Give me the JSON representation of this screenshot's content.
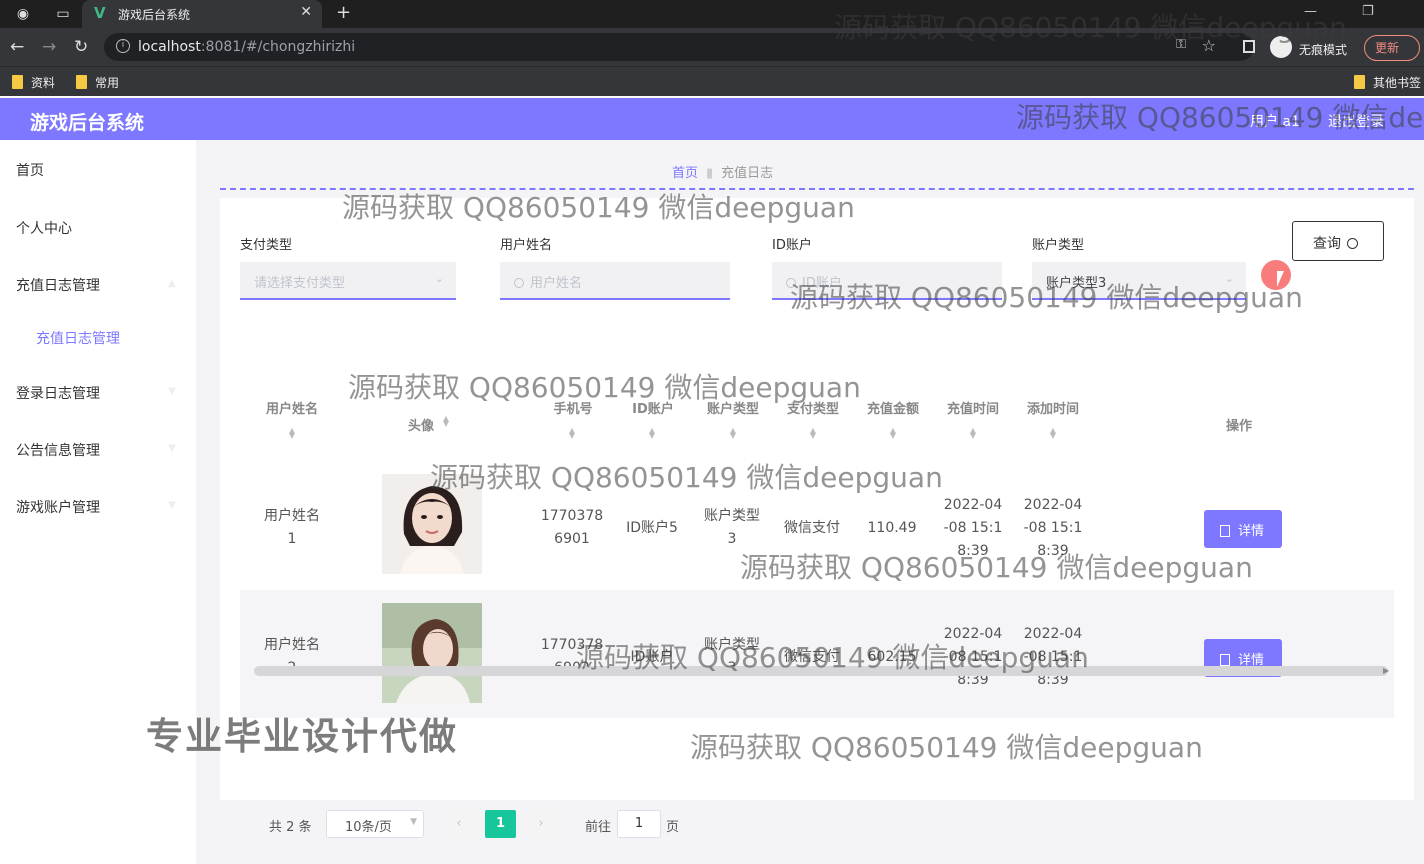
{
  "browser": {
    "tab_title": "游戏后台系统",
    "url_host": "localhost",
    "url_rest": ":8081/#/chongzhirizhi",
    "incognito_label": "无痕模式",
    "update_label": "更新",
    "bookmarks": [
      "资料",
      "常用",
      "其他书签"
    ]
  },
  "header": {
    "title": "游戏后台系统",
    "user_label": "用户 a1",
    "logout_label": "退出登录"
  },
  "sidebar": {
    "items": [
      {
        "label": "首页"
      },
      {
        "label": "个人中心"
      },
      {
        "label": "充值日志管理"
      },
      {
        "label": "充值日志管理"
      },
      {
        "label": "登录日志管理"
      },
      {
        "label": "公告信息管理"
      },
      {
        "label": "游戏账户管理"
      }
    ]
  },
  "breadcrumb": {
    "home": "首页",
    "current": "充值日志"
  },
  "filters": {
    "pay_type": {
      "label": "支付类型",
      "placeholder": "请选择支付类型"
    },
    "user_name": {
      "label": "用户姓名",
      "placeholder": "用户姓名"
    },
    "id_account": {
      "label": "ID账户",
      "placeholder": "ID账户"
    },
    "account_type": {
      "label": "账户类型",
      "value": "账户类型3"
    },
    "query_label": "查询"
  },
  "table": {
    "columns": [
      "用户姓名",
      "头像",
      "手机号",
      "ID账户",
      "账户类型",
      "支付类型",
      "充值金额",
      "充值时间",
      "添加时间",
      "操作"
    ],
    "rows": [
      {
        "name": [
          "用户姓名",
          "1"
        ],
        "phone": [
          "1770378",
          "6901"
        ],
        "id_account": "ID账户5",
        "account_type": [
          "账户类型",
          "3"
        ],
        "pay_type": "微信支付",
        "amount": "110.49",
        "charge_time": [
          "2022-04",
          "-08 15:1",
          "8:39"
        ],
        "add_time": [
          "2022-04",
          "-08 15:1",
          "8:39"
        ],
        "action": "详情"
      },
      {
        "name": [
          "用户姓名",
          "2"
        ],
        "phone": [
          "1770378",
          "6902"
        ],
        "id_account": "ID账户",
        "account_type": [
          "账户类型",
          "3"
        ],
        "pay_type": "微信支付",
        "amount": "602.15",
        "charge_time": [
          "2022-04",
          "-08 15:1",
          "8:39"
        ],
        "add_time": [
          "2022-04",
          "-08 15:1",
          "8:39"
        ],
        "action": "详情"
      }
    ]
  },
  "pagination": {
    "total": "共 2 条",
    "page_size": "10条/页",
    "current_page": "1",
    "goto_label": "前往",
    "goto_value": "1",
    "page_suffix": "页"
  },
  "watermarks": {
    "text": "源码获取 QQ86050149 微信deepguan",
    "big_text": "专业毕业设计代做"
  },
  "colors": {
    "accent": "#7d78ff",
    "page_active": "#17c79b",
    "cursor_highlight": "#f55050"
  }
}
